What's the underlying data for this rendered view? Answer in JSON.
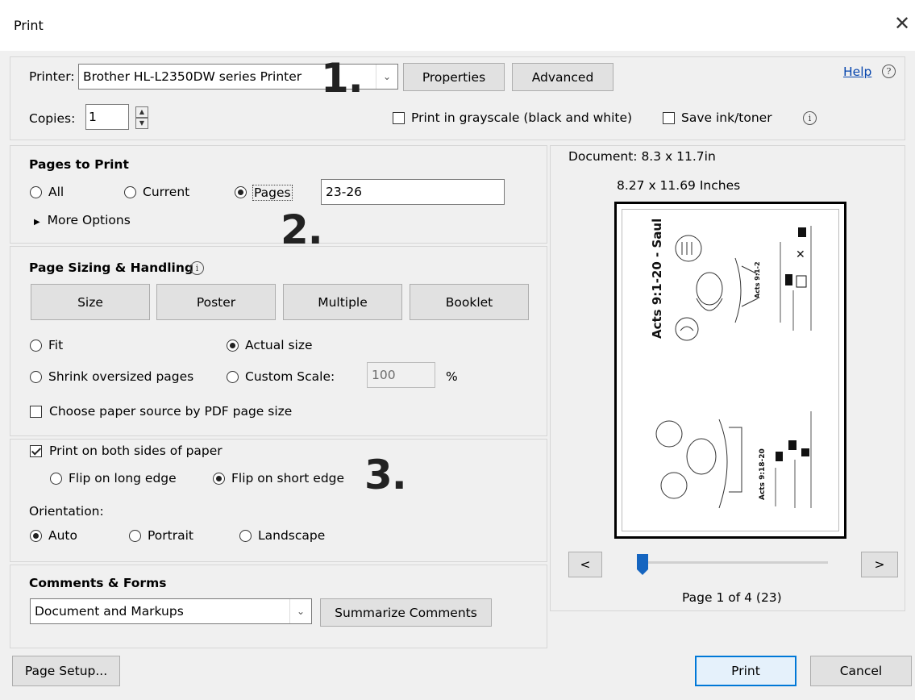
{
  "window": {
    "title": "Print",
    "close_icon": "close-icon"
  },
  "printer": {
    "label": "Printer:",
    "value": "Brother HL-L2350DW series Printer",
    "properties_label": "Properties",
    "advanced_label": "Advanced",
    "help_label": "Help",
    "copies_label": "Copies:",
    "copies_value": "1",
    "grayscale_label": "Print in grayscale (black and white)",
    "grayscale_checked": false,
    "save_ink_label": "Save ink/toner",
    "save_ink_checked": false
  },
  "annotations": {
    "one": "1.",
    "two": "2.",
    "three": "3."
  },
  "pages_to_print": {
    "heading": "Pages to Print",
    "all_label": "All",
    "current_label": "Current",
    "pages_label": "Pages",
    "pages_value": "23-26",
    "selected": "pages",
    "more_options_label": "More Options"
  },
  "page_sizing": {
    "heading": "Page Sizing & Handling",
    "size_label": "Size",
    "poster_label": "Poster",
    "multiple_label": "Multiple",
    "booklet_label": "Booklet",
    "fit_label": "Fit",
    "actual_size_label": "Actual size",
    "shrink_label": "Shrink oversized pages",
    "custom_scale_label": "Custom Scale:",
    "custom_scale_value": "100",
    "percent_label": "%",
    "selected": "actual_size",
    "paper_source_label": "Choose paper source by PDF page size",
    "paper_source_checked": false
  },
  "duplex": {
    "both_sides_label": "Print on both sides of paper",
    "both_sides_checked": true,
    "long_edge_label": "Flip on long edge",
    "short_edge_label": "Flip on short edge",
    "selected_flip": "short_edge",
    "orientation_label": "Orientation:",
    "auto_label": "Auto",
    "portrait_label": "Portrait",
    "landscape_label": "Landscape",
    "selected_orientation": "auto"
  },
  "comments_forms": {
    "heading": "Comments & Forms",
    "value": "Document and Markups",
    "summarize_label": "Summarize Comments"
  },
  "preview": {
    "document_size": "Document: 8.3 x 11.7in",
    "paper_size": "8.27 x 11.69 Inches",
    "prev_label": "<",
    "next_label": ">",
    "page_info": "Page 1 of 4 (23)",
    "slider_position": 0.0,
    "top_title": "Acts 9:1-20 - Saul",
    "top_subtitle": "Acts 9:1-2",
    "bottom_title": "Acts 9:18-20"
  },
  "footer": {
    "page_setup_label": "Page Setup...",
    "print_label": "Print",
    "cancel_label": "Cancel"
  },
  "colors": {
    "accent": "#0078d7",
    "slider": "#1565c0",
    "link": "#0645ad"
  }
}
